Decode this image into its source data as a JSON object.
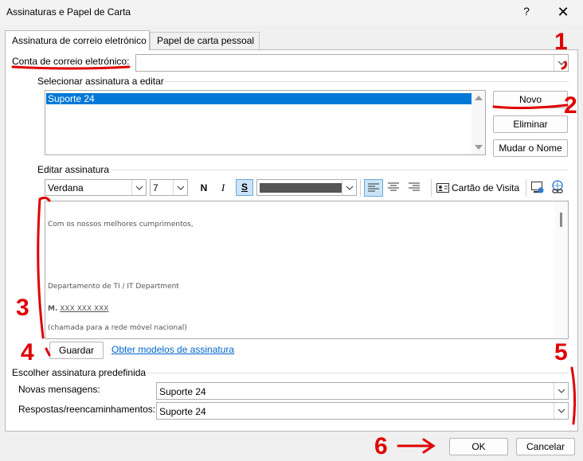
{
  "window": {
    "title": "Assinaturas e Papel de Carta",
    "help_glyph": "?",
    "close_glyph": "✕"
  },
  "tabs": [
    {
      "label": "Assinatura de correio eletrónico",
      "selected": true
    },
    {
      "label": "Papel de carta pessoal",
      "selected": false
    }
  ],
  "account": {
    "label": "Conta de correio eletrónico:",
    "value": "."
  },
  "select_signature": {
    "group_title": "Selecionar assinatura a editar",
    "items": [
      "Suporte 24"
    ],
    "selected_index": 0
  },
  "buttons": {
    "new": "Novo",
    "delete": "Eliminar",
    "rename": "Mudar o Nome",
    "save": "Guardar",
    "ok": "OK",
    "cancel": "Cancelar"
  },
  "edit_signature": {
    "group_title": "Editar assinatura",
    "font": "Verdana",
    "size": "7",
    "bold": "N",
    "italic": "I",
    "underline": "S",
    "text_color": "#555555",
    "business_card": "Cartão de Visita",
    "content": {
      "greeting": "Com os nossos melhores cumprimentos,",
      "department": "Departamento de TI / IT Department",
      "mobile_prefix": "M.",
      "mobile_number": "XXX XXX XXX",
      "note": "(chamada para a rede móvel nacional)"
    }
  },
  "templates_link": "Obter modelos de assinatura",
  "default_signature": {
    "group_title": "Escolher assinatura predefinida",
    "new_messages_label": "Novas mensagens:",
    "new_messages_value": "Suporte 24",
    "replies_label": "Respostas/reencaminhamentos:",
    "replies_value": "Suporte 24"
  },
  "annotations": {
    "color": "#e00000",
    "labels": [
      "1",
      "2",
      "3",
      "4",
      "5",
      "6"
    ]
  },
  "icons": {
    "dropdown": "chevron-down-icon",
    "business_card": "contact-card-icon",
    "picture": "insert-picture-icon",
    "hyperlink": "hyperlink-icon",
    "align_left": "align-left-icon",
    "align_center": "align-center-icon",
    "align_right": "align-right-icon"
  }
}
